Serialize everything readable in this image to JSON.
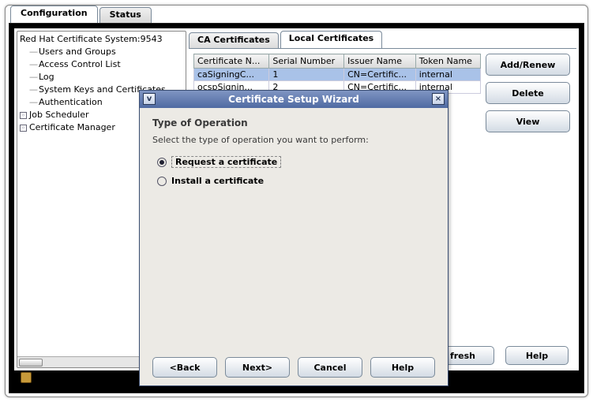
{
  "tabs": {
    "configuration": "Configuration",
    "status": "Status"
  },
  "tree": {
    "root": "Red Hat Certificate System:9543",
    "items": [
      "Users and Groups",
      "Access Control List",
      "Log",
      "System Keys and Certificates",
      "Authentication"
    ],
    "expandable": [
      "Job Scheduler",
      "Certificate Manager"
    ]
  },
  "subtabs": {
    "ca": "CA Certificates",
    "local": "Local Certificates"
  },
  "cert_table": {
    "headers": [
      "Certificate N...",
      "Serial Number",
      "Issuer Name",
      "Token Name"
    ],
    "rows": [
      [
        "caSigningC...",
        "1",
        "CN=Certific...",
        "internal"
      ],
      [
        "ocspSignin...",
        "2",
        "CN=Certific...",
        "internal"
      ]
    ]
  },
  "side_buttons": {
    "add": "Add/Renew",
    "delete": "Delete",
    "view": "View"
  },
  "bottom": {
    "refresh": "fresh",
    "help": "Help"
  },
  "wizard": {
    "title": "Certificate Setup Wizard",
    "heading": "Type of Operation",
    "desc": "Select the type of operation you want to perform:",
    "opt_request": "Request a certificate",
    "opt_install": "Install a certificate",
    "back": "<Back",
    "next": "Next>",
    "cancel": "Cancel",
    "help": "Help"
  }
}
